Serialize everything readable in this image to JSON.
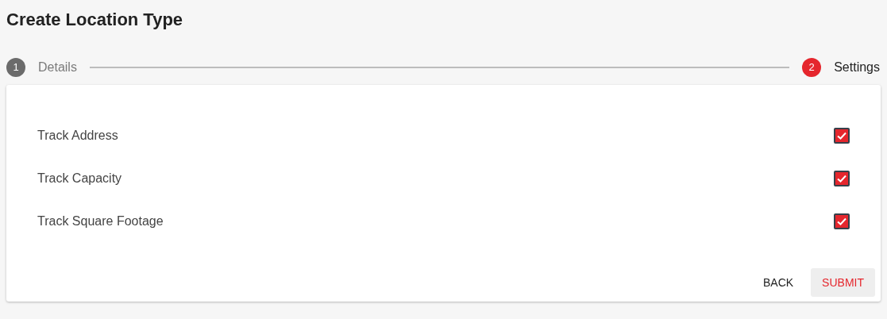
{
  "title": "Create Location Type",
  "steps": [
    {
      "number": "1",
      "label": "Details",
      "active": false
    },
    {
      "number": "2",
      "label": "Settings",
      "active": true
    }
  ],
  "settings": [
    {
      "label": "Track Address",
      "checked": true
    },
    {
      "label": "Track Capacity",
      "checked": true
    },
    {
      "label": "Track Square Footage",
      "checked": true
    }
  ],
  "buttons": [
    {
      "label": "BACK",
      "kind": "text"
    },
    {
      "label": "SUBMIT",
      "kind": "primary"
    }
  ]
}
